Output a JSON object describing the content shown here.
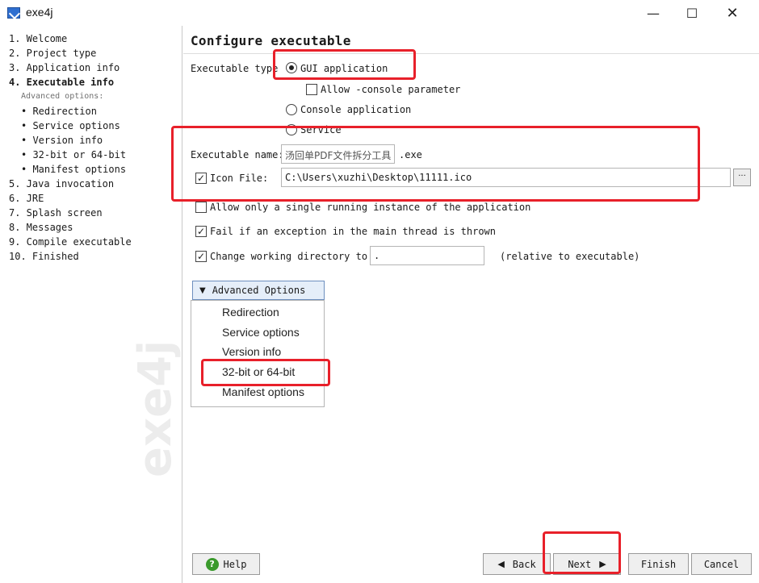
{
  "window": {
    "title": "exe4j"
  },
  "title_buttons": {
    "minimize": "—",
    "maximize": "☐",
    "close": "✕"
  },
  "sidebar": {
    "steps": [
      "1. Welcome",
      "2. Project type",
      "3. Application info",
      "4. Executable info",
      "5. Java invocation",
      "6. JRE",
      "7. Splash screen",
      "8. Messages",
      "9. Compile executable",
      "10. Finished"
    ],
    "advanced_caption": "Advanced options:",
    "sub_steps": [
      "• Redirection",
      "• Service options",
      "• Version info",
      "• 32-bit or 64-bit",
      "• Manifest options"
    ],
    "watermark": "exe4j"
  },
  "main": {
    "title": "Configure executable",
    "exe_type_label": "Executable type",
    "gui_option": "GUI application",
    "allow_console": "Allow -console parameter",
    "console_option": "Console application",
    "service_option": "Service",
    "exe_name_label": "Executable name:",
    "exe_name_value": "汤回单PDF文件拆分工具",
    "exe_suffix": ".exe",
    "icon_file_label": "Icon File:",
    "icon_file_value": "C:\\Users\\xuzhi\\Desktop\\11111.ico",
    "icon_browse": "···",
    "single_instance": "Allow only a single running instance of the application",
    "fail_exception": "Fail if an exception in the main thread is thrown",
    "change_dir_label": "Change working directory to:",
    "change_dir_value": ".",
    "relative_note": "(relative to executable)",
    "advanced_button": "Advanced Options",
    "advanced_items": [
      "Redirection",
      "Service options",
      "Version info",
      "32-bit or 64-bit",
      "Manifest options"
    ]
  },
  "buttons": {
    "help": "Help",
    "back": "Back",
    "next": "Next",
    "finish": "Finish",
    "cancel": "Cancel"
  },
  "colors": {
    "highlight": "#e8202a",
    "accent": "#2f6fd0"
  }
}
